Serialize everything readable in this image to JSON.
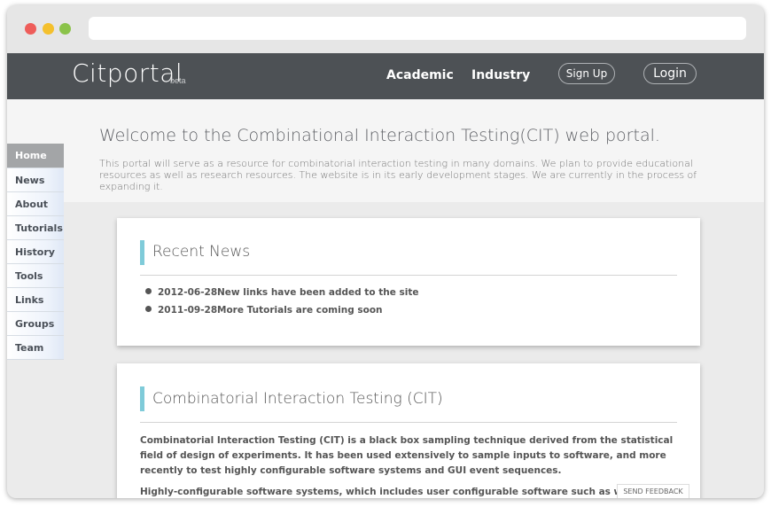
{
  "header": {
    "logo": "Citportal",
    "beta": "beta",
    "nav": {
      "academic": "Academic",
      "industry": "Industry"
    },
    "signup": "Sign Up",
    "login": "Login"
  },
  "hero": {
    "title": "Welcome to the Combinational Interaction Testing(CIT) web portal.",
    "text": "This portal will serve as a resource for combinatorial interaction testing in many domains. We plan to provide educational resources as well as research resources. The website is in its early development stages. We are currently in the process of expanding it."
  },
  "sidebar": {
    "items": [
      "Home",
      "News",
      "About",
      "Tutorials",
      "History",
      "Tools",
      "Links",
      "Groups",
      "Team"
    ],
    "active": "Home"
  },
  "news": {
    "title": "Recent News",
    "items": [
      {
        "date": "2012-06-28",
        "text": "New links have been added to the site"
      },
      {
        "date": "2011-09-28",
        "text": "More Tutorials are coming soon"
      }
    ]
  },
  "cit": {
    "title": "Combinatorial Interaction Testing (CIT)",
    "para1": "Combinatorial Interaction Testing (CIT) is a black box sampling technique derived from the statistical field of design of experiments. It has been used extensively to sample inputs to software, and more recently to test highly configurable software systems and GUI event sequences.",
    "para2": "Highly-configurable software systems, which includes user configurable software such as web browsers"
  },
  "feedback": "SEND FEEDBACK",
  "colors": {
    "header": "#4d5155",
    "accent": "#7fcbd9",
    "sidebar_active": "#a3a5a7"
  }
}
